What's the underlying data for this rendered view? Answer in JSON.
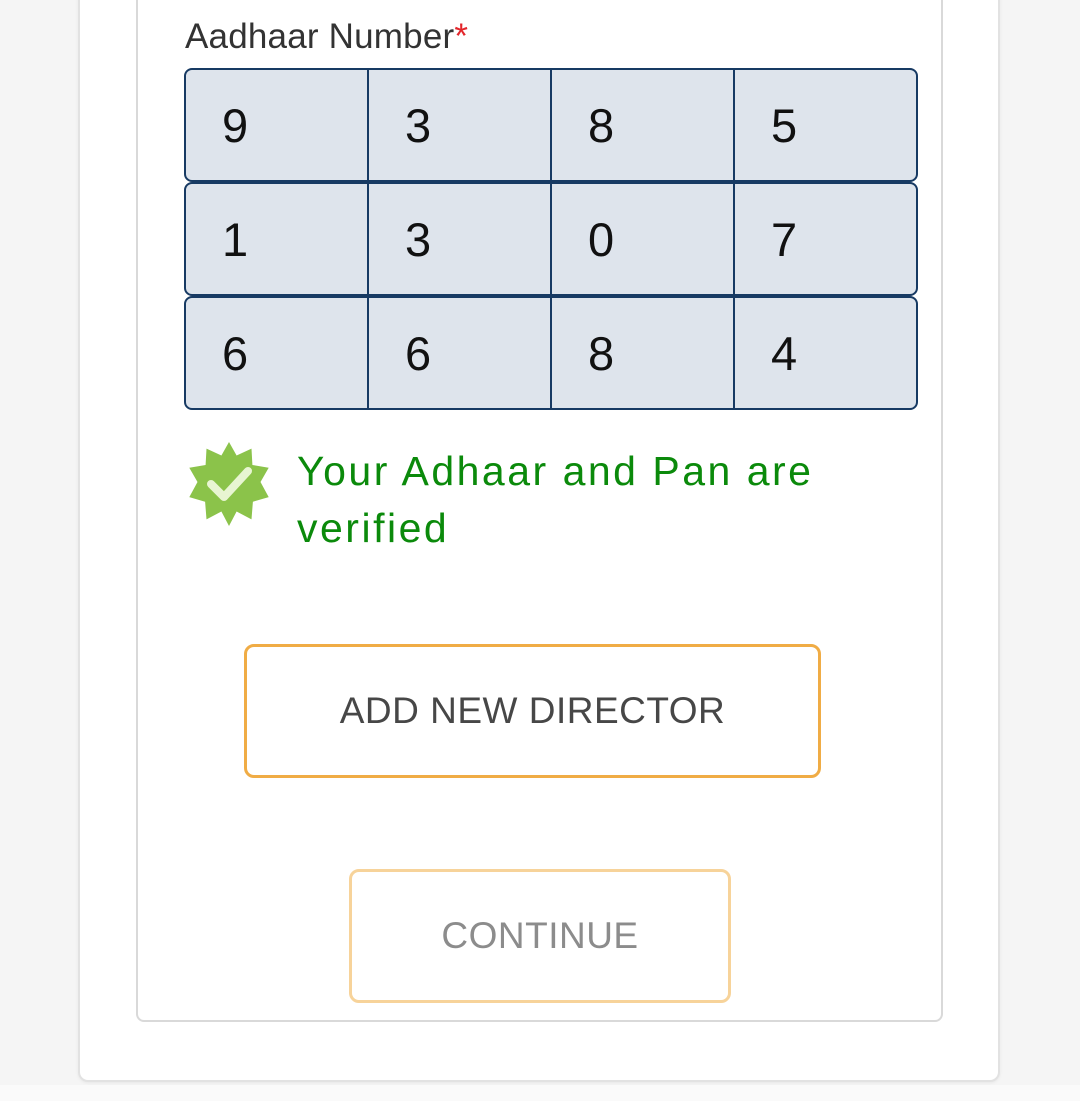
{
  "form": {
    "aadhaar_label": "Aadhaar Number",
    "required_marker": "*",
    "aadhaar_rows": [
      [
        "9",
        "3",
        "8",
        "5"
      ],
      [
        "1",
        "3",
        "0",
        "7"
      ],
      [
        "6",
        "6",
        "8",
        "4"
      ]
    ]
  },
  "verification": {
    "message": "Your Adhaar and Pan are verified",
    "icon": "verified-badge-icon",
    "color": "#0b8a0b",
    "badge_color": "#8bc34a"
  },
  "actions": {
    "add_director_label": "ADD NEW DIRECTOR",
    "continue_label": "CONTINUE",
    "accent": "#f0ac45"
  }
}
